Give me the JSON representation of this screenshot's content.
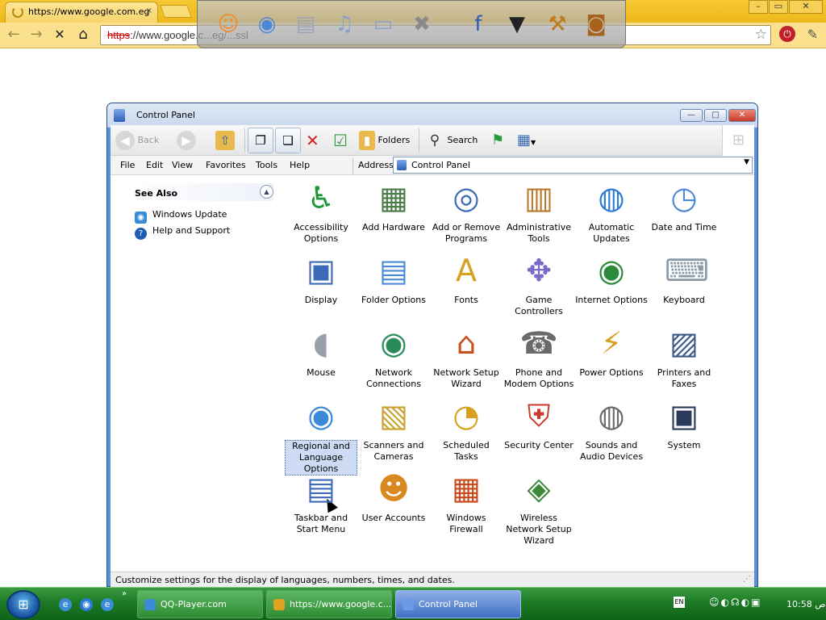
{
  "browser": {
    "tab_title": "https://www.google.com.eg",
    "tab_close": "×",
    "window_controls": [
      "–",
      "▭",
      "✕"
    ],
    "url_scheme": "https",
    "url_rest": "://www.google.c...eg/...ssl",
    "nav": {
      "back": "←",
      "forward": "→",
      "stop": "✕",
      "home": "⌂"
    }
  },
  "dock": {
    "items": [
      {
        "name": "naruto-avatar",
        "glyph": "☺",
        "color": "#f08a2c"
      },
      {
        "name": "globe-icon",
        "glyph": "◉",
        "color": "#4a88d8"
      },
      {
        "name": "document-icon",
        "glyph": "▤",
        "color": "#9aa4b4"
      },
      {
        "name": "music-folder-icon",
        "glyph": "♫",
        "color": "#8aa2c8"
      },
      {
        "name": "folder-icon",
        "glyph": "▭",
        "color": "#8aa2c8"
      },
      {
        "name": "tools-icon",
        "glyph": "✖",
        "color": "#8a8a8a"
      },
      {
        "name": "facebook-icon",
        "glyph": "f",
        "color": "#2b5fb8"
      },
      {
        "name": "tshirt-icon",
        "glyph": "▼",
        "color": "#222222"
      },
      {
        "name": "hammer-icon",
        "glyph": "⚒",
        "color": "#c07a1a"
      },
      {
        "name": "barrel-icon",
        "glyph": "◙",
        "color": "#a8621e"
      }
    ]
  },
  "window": {
    "title": "Control Panel",
    "controls": [
      "—",
      "□",
      "✕"
    ],
    "toolbar": {
      "back": "Back",
      "folders": "Folders",
      "search": "Search"
    },
    "menu": [
      "File",
      "Edit",
      "View",
      "Favorites",
      "Tools",
      "Help"
    ],
    "address_label": "Address",
    "address_value": "Control Panel",
    "see_also": {
      "title": "See Also",
      "links": [
        {
          "label": "Windows Update",
          "icon": "windows-update-icon",
          "color": "#3a8bd8"
        },
        {
          "label": "Help and Support",
          "icon": "help-support-icon",
          "color": "#1f5db4"
        }
      ]
    },
    "items": [
      {
        "label": "Accessibility Options",
        "icon": "accessibility-icon",
        "glyph": "♿",
        "color": "#1a9a3a"
      },
      {
        "label": "Add Hardware",
        "icon": "add-hardware-icon",
        "glyph": "▦",
        "color": "#4a7a4a"
      },
      {
        "label": "Add or Remove Programs",
        "icon": "add-remove-programs-icon",
        "glyph": "◎",
        "color": "#3a6ab8"
      },
      {
        "label": "Administrative Tools",
        "icon": "administrative-tools-icon",
        "glyph": "▥",
        "color": "#b87a2a"
      },
      {
        "label": "Automatic Updates",
        "icon": "automatic-updates-icon",
        "glyph": "◍",
        "color": "#2a7ad8"
      },
      {
        "label": "Date and Time",
        "icon": "date-time-icon",
        "glyph": "◷",
        "color": "#4a8ad8"
      },
      {
        "label": "Display",
        "icon": "display-icon",
        "glyph": "▣",
        "color": "#3a6ab8"
      },
      {
        "label": "Folder Options",
        "icon": "folder-options-icon",
        "glyph": "▤",
        "color": "#4a8ad8"
      },
      {
        "label": "Fonts",
        "icon": "fonts-icon",
        "glyph": "A",
        "color": "#d8a020"
      },
      {
        "label": "Game Controllers",
        "icon": "game-controllers-icon",
        "glyph": "✥",
        "color": "#7a6ac8"
      },
      {
        "label": "Internet Options",
        "icon": "internet-options-icon",
        "glyph": "◉",
        "color": "#2a8a3a"
      },
      {
        "label": "Keyboard",
        "icon": "keyboard-icon",
        "glyph": "⌨",
        "color": "#8a9aa8"
      },
      {
        "label": "Mouse",
        "icon": "mouse-icon",
        "glyph": "◖",
        "color": "#9aa0a8"
      },
      {
        "label": "Network Connections",
        "icon": "network-connections-icon",
        "glyph": "◉",
        "color": "#2a8a5a"
      },
      {
        "label": "Network Setup Wizard",
        "icon": "network-setup-wizard-icon",
        "glyph": "⌂",
        "color": "#c8501a"
      },
      {
        "label": "Phone and Modem Options",
        "icon": "phone-modem-icon",
        "glyph": "☎",
        "color": "#6a6a6a"
      },
      {
        "label": "Power Options",
        "icon": "power-options-icon",
        "glyph": "⚡",
        "color": "#d8a020"
      },
      {
        "label": "Printers and Faxes",
        "icon": "printers-faxes-icon",
        "glyph": "▨",
        "color": "#3a5a8a"
      },
      {
        "label": "Regional and Language Options",
        "icon": "regional-language-icon",
        "glyph": "◉",
        "color": "#3a8ad8"
      },
      {
        "label": "Scanners and Cameras",
        "icon": "scanners-cameras-icon",
        "glyph": "▧",
        "color": "#c8a030"
      },
      {
        "label": "Scheduled Tasks",
        "icon": "scheduled-tasks-icon",
        "glyph": "◔",
        "color": "#d8a020"
      },
      {
        "label": "Security Center",
        "icon": "security-center-icon",
        "glyph": "⛨",
        "color": "#c83a2a"
      },
      {
        "label": "Sounds and Audio Devices",
        "icon": "sounds-audio-icon",
        "glyph": "◍",
        "color": "#6a6a6a"
      },
      {
        "label": "System",
        "icon": "system-icon",
        "glyph": "▣",
        "color": "#2a3a5a"
      },
      {
        "label": "Taskbar and Start Menu",
        "icon": "taskbar-start-menu-icon",
        "glyph": "▤",
        "color": "#3a6ab8"
      },
      {
        "label": "User Accounts",
        "icon": "user-accounts-icon",
        "glyph": "☻",
        "color": "#d88a20"
      },
      {
        "label": "Windows Firewall",
        "icon": "windows-firewall-icon",
        "glyph": "▦",
        "color": "#c84a1a"
      },
      {
        "label": "Wireless Network Setup Wizard",
        "icon": "wireless-network-icon",
        "glyph": "◈",
        "color": "#3a8a3a"
      }
    ],
    "selected_item": "Regional and Language Options",
    "status": "Customize settings for the display of languages, numbers, times, and dates."
  },
  "taskbar": {
    "tasks": [
      {
        "label": "QQ-Player.com",
        "icon": "ie-icon",
        "color": "#3a8bd8",
        "active": false
      },
      {
        "label": "https://www.google.c...",
        "icon": "chrome-icon",
        "color": "#e0a020",
        "active": false
      },
      {
        "label": "Control Panel",
        "icon": "control-panel-icon",
        "color": "#6a9ae8",
        "active": true
      }
    ],
    "quick_launch_more": "»",
    "lang": "EN",
    "clock": "10:58 ص"
  }
}
